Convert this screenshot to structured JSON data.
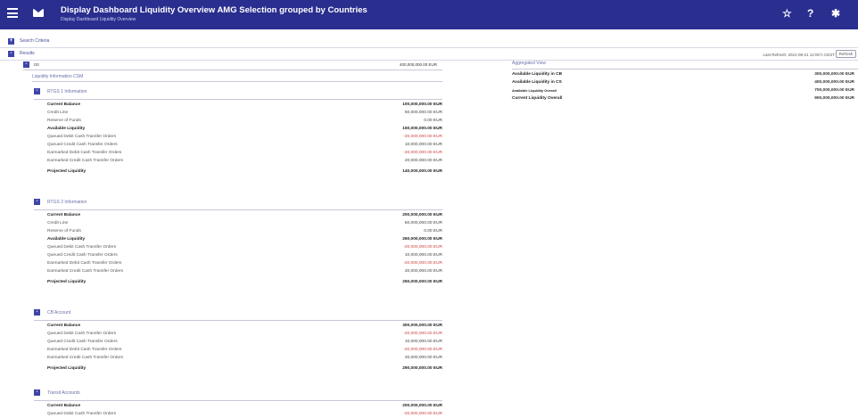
{
  "header": {
    "title": "Display Dashboard Liquidity Overview AMG Selection grouped by Countries",
    "subtitle": "Display Dashboard Liquidity Overview",
    "icons": [
      "menu-icon",
      "mail-icon",
      "star-icon",
      "help-icon",
      "gear-icon"
    ],
    "star_glyph": "☆",
    "help_glyph": "?",
    "gear_glyph": "✱",
    "background_color": "#2a2e8f"
  },
  "search_criteria": {
    "label": "Search Criteria",
    "toggle": "+"
  },
  "results": {
    "label": "Results",
    "toggle": "-"
  },
  "last_refresh": "Last Refresh: 2021-08-21 12:00 h CEST",
  "refresh_button": "Refresh",
  "group": {
    "label": "DE",
    "value": "400,000,000.00 EUR",
    "toggle": "-"
  },
  "liquidity_information_label": "Liquidity Information CSM",
  "sections": [
    {
      "title": "RTGS 1 Information",
      "toggle": "-",
      "rows": [
        {
          "label": "Current Balance",
          "value": "100,000,000.00 EUR"
        },
        {
          "label": "Credit Line",
          "value": "50,000,000.00 EUR"
        },
        {
          "label": "Reserve of Funds",
          "value": "0.00 EUR"
        },
        {
          "label": "Available Liquidity",
          "value": "150,000,000.00 EUR"
        },
        {
          "label": "Queued Debit Cash Transfer Orders",
          "value": "-20,000,000.00 EUR"
        },
        {
          "label": "Queued Credit Cash Transfer Orders",
          "value": "10,000,000.00 EUR"
        },
        {
          "label": "Earmarked Debit Cash Transfer Orders",
          "value": "-20,000,000.00 EUR"
        },
        {
          "label": "Earmarked Credit Cash Transfer Orders",
          "value": "20,000,000.00 EUR"
        },
        {
          "label": "Projected Liquidity",
          "value": "140,000,000.00 EUR"
        }
      ]
    },
    {
      "title": "RTGS 2 Information",
      "toggle": "-",
      "rows": [
        {
          "label": "Current Balance",
          "value": "200,000,000.00 EUR"
        },
        {
          "label": "Credit Line",
          "value": "60,000,000.00 EUR"
        },
        {
          "label": "Reserve of Funds",
          "value": "0.00 EUR"
        },
        {
          "label": "Available Liquidity",
          "value": "260,000,000.00 EUR"
        },
        {
          "label": "Queued Debit Cash Transfer Orders",
          "value": "-20,000,000.00 EUR"
        },
        {
          "label": "Queued Credit Cash Transfer Orders",
          "value": "10,000,000.00 EUR"
        },
        {
          "label": "Earmarked Debit Cash Transfer Orders",
          "value": "-20,000,000.00 EUR"
        },
        {
          "label": "Earmarked Credit Cash Transfer Orders",
          "value": "20,000,000.00 EUR"
        },
        {
          "label": "Projected Liquidity",
          "value": "250,000,000.00 EUR"
        }
      ]
    },
    {
      "title": "CB Account",
      "toggle": "-",
      "rows": [
        {
          "label": "Current Balance",
          "value": "300,000,000.00 EUR"
        },
        {
          "label": "Queued Debit Cash Transfer Orders",
          "value": "-20,000,000.00 EUR"
        },
        {
          "label": "Queued Credit Cash Transfer Orders",
          "value": "10,000,000.00 EUR"
        },
        {
          "label": "Earmarked Debit Cash Transfer Orders",
          "value": "-20,000,000.00 EUR"
        },
        {
          "label": "Earmarked Credit Cash Transfer Orders",
          "value": "20,000,000.00 EUR"
        },
        {
          "label": "Projected Liquidity",
          "value": "290,000,000.00 EUR"
        }
      ]
    },
    {
      "title": "Transit Accounts",
      "toggle": "-",
      "rows": [
        {
          "label": "Current Balance",
          "value": "200,000,000.00 EUR"
        },
        {
          "label": "Queued Debit Cash Transfer Orders",
          "value": "-20,000,000.00 EUR"
        }
      ]
    }
  ],
  "aggregated": {
    "title": "Aggregated View",
    "rows": [
      {
        "label": "Available Liquidity in CB",
        "value": "300,000,000.00 EUR"
      },
      {
        "label": "Available Liquidity in CS",
        "value": "400,000,000.00 EUR"
      },
      {
        "label": "Available Liquidity Overall",
        "value": "700,000,000.00 EUR"
      },
      {
        "label": "Current Liquidity Overall",
        "value": "900,000,000.00 EUR"
      }
    ]
  },
  "colors": {
    "accent": "#3e44a8",
    "negative": "#cc4444",
    "section_title": "#6a6fa8"
  }
}
